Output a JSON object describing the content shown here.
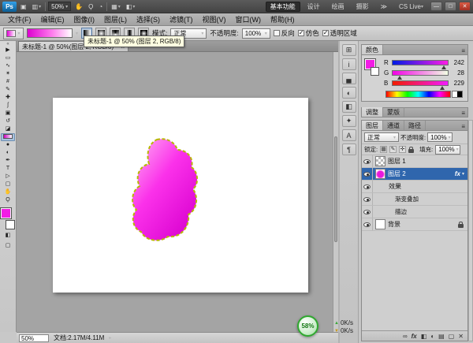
{
  "app_bar": {
    "logo": "Ps",
    "zoom_level": "50%",
    "workspaces": [
      "基本功能",
      "设计",
      "绘画",
      "摄影"
    ],
    "cs_live": "CS Live",
    "window": {
      "minimize": "—",
      "maximize": "□",
      "close": "✕"
    }
  },
  "menu_bar": {
    "items": [
      "文件(F)",
      "编辑(E)",
      "图像(I)",
      "图层(L)",
      "选择(S)",
      "滤镜(T)",
      "视图(V)",
      "窗口(W)",
      "帮助(H)"
    ]
  },
  "options_bar": {
    "mode_label": "模式:",
    "mode_value": "正常",
    "opacity_label": "不透明度:",
    "opacity_value": "100%",
    "reverse_label": "反向",
    "dither_label": "仿色",
    "transparency_label": "透明区域"
  },
  "document": {
    "tab_title": "未标题-1 @ 50%(图层 2, RGB/8) *",
    "tooltip": "未标题-1 @ 50% (图层 2, RGB/8)"
  },
  "status_bar": {
    "zoom": "50%",
    "doc_info": "文档:2.17M/4.11M"
  },
  "color_panel": {
    "title": "颜色",
    "channels": [
      {
        "label": "R",
        "value": "242"
      },
      {
        "label": "G",
        "value": "28"
      },
      {
        "label": "B",
        "value": "229"
      }
    ]
  },
  "collapsed_panels": {
    "tabs": [
      "调整",
      "蒙版"
    ]
  },
  "layers_panel": {
    "tabs": [
      "图层",
      "通道",
      "路径"
    ],
    "blend_mode": "正常",
    "opacity_label": "不透明度:",
    "opacity_value": "100%",
    "lock_label": "锁定:",
    "fill_label": "填充:",
    "fill_value": "100%",
    "fx_badge": "fx",
    "layers": {
      "layer1": "图层 1",
      "layer2": "图层 2",
      "effects": "效果",
      "gradient_overlay": "渐变叠加",
      "stroke": "描边",
      "background": "背景"
    }
  },
  "overlays": {
    "progress": "58%",
    "net_up": "0K/s",
    "net_down": "0K/s"
  },
  "icons": {
    "dropdown": "▾",
    "panel_menu": "≡",
    "collapse": "«",
    "tab_close": "×",
    "expand": "▸",
    "double_arrow": "≫",
    "up_arrow": "▲",
    "down_arrow": "▼",
    "app": [
      "▣",
      "▥",
      "✋",
      "Ϙ",
      "◔",
      "▦",
      "◧"
    ],
    "tools": [
      "▶",
      "▭",
      "∿",
      "✶",
      "#",
      "✎",
      "✚",
      "ʃ",
      "▣",
      "↺",
      "◪",
      "",
      "●",
      "◐",
      "✒",
      "T",
      "▷",
      "▢",
      "✋",
      "Ϙ"
    ],
    "dock": [
      "⊞",
      "i",
      "▄",
      "◐",
      "◧",
      "✦",
      "A",
      "¶"
    ],
    "footer": [
      "∞",
      "fx",
      "◧",
      "◐",
      "▤",
      "▢",
      "✕"
    ],
    "locks": [
      "▦",
      "✎",
      "✛"
    ],
    "quick_mask": "◧",
    "screen_mode": "▢"
  },
  "colors": {
    "foreground": "#f21ce5",
    "background": "#ffffff",
    "selection_blue": "#2f66ad",
    "blob_light": "#ffb4f4",
    "blob_dark": "#d800cf",
    "stroke_yellow": "#b6b800"
  }
}
